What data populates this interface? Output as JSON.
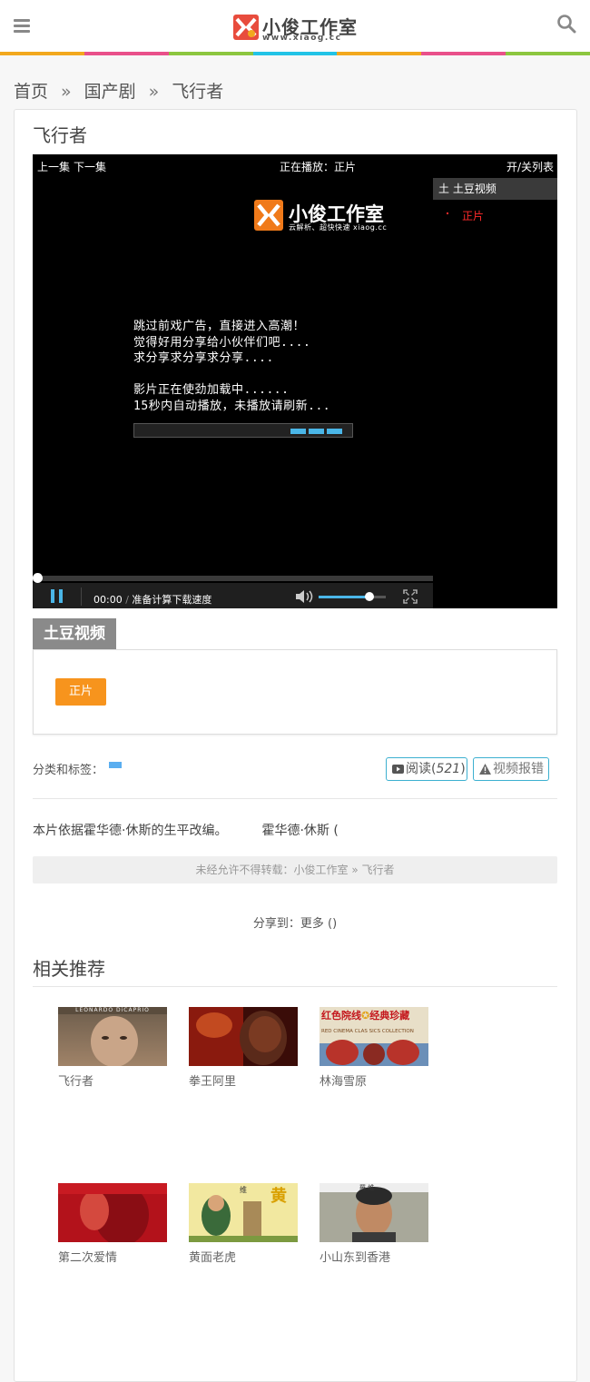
{
  "header": {
    "logo_title": "小俊工作室",
    "logo_url": "www.xiaog.cc",
    "colorbar": [
      "#f2a81d",
      "#e9508a",
      "#8cc63f",
      "#22c3e6",
      "#f2a81d",
      "#e9508a",
      "#8cc63f"
    ]
  },
  "breadcrumb": {
    "home": "首页",
    "category": "国产剧",
    "current": "飞行者",
    "separator": "»"
  },
  "post": {
    "title": "飞行者"
  },
  "player": {
    "prev": "上一集",
    "next": "下一集",
    "now_playing": "正在播放：正片",
    "toggle_list": "开/关列表",
    "list_source": "土 土豆视频",
    "list_item": "正片",
    "brand_title": "小俊工作室",
    "brand_sub": "云解析、超快快速  xiaog.cc",
    "message": "跳过前戏广告，直接进入高潮！\n觉得好用分享给小伙伴们吧....\n求分享求分享求分享....\n\n影片正在使劲加载中......\n15秒内自动播放，未播放请刷新...",
    "time": "00:00",
    "status": "准备计算下载速度",
    "volume_level": 0.75
  },
  "source": {
    "tab": "土豆视频",
    "episode": "正片"
  },
  "meta": {
    "tags_label": "分类和标签：",
    "read_label": "阅读(",
    "read_count": "521",
    "read_close": ")",
    "report_label": "视频报错",
    "excerpt_a": "本片依据霍华德·休斯的生平改编。",
    "excerpt_b": "霍华德·休斯 (",
    "copy_note": "未经允许不得转载：小俊工作室 » 飞行者",
    "share_prefix": "分享到：",
    "share_more": "更多",
    "share_count": "()"
  },
  "related": {
    "title": "相关推荐",
    "items": [
      {
        "title": "飞行者"
      },
      {
        "title": "拳王阿里"
      },
      {
        "title": "林海雪原"
      },
      {
        "title": "第二次爱情"
      },
      {
        "title": "黄面老虎"
      },
      {
        "title": "小山东到香港"
      }
    ],
    "thumb_texts": {
      "t1": "LEONARDO DiCAPRIO",
      "t3_a": "红色院线",
      "t3_b": "经典珍藏",
      "t3_c": "RED CINEMA CLAS  SICS COLLECTION",
      "t5_a": "黄",
      "t5_b": "维",
      "t6": "羅 維"
    }
  }
}
